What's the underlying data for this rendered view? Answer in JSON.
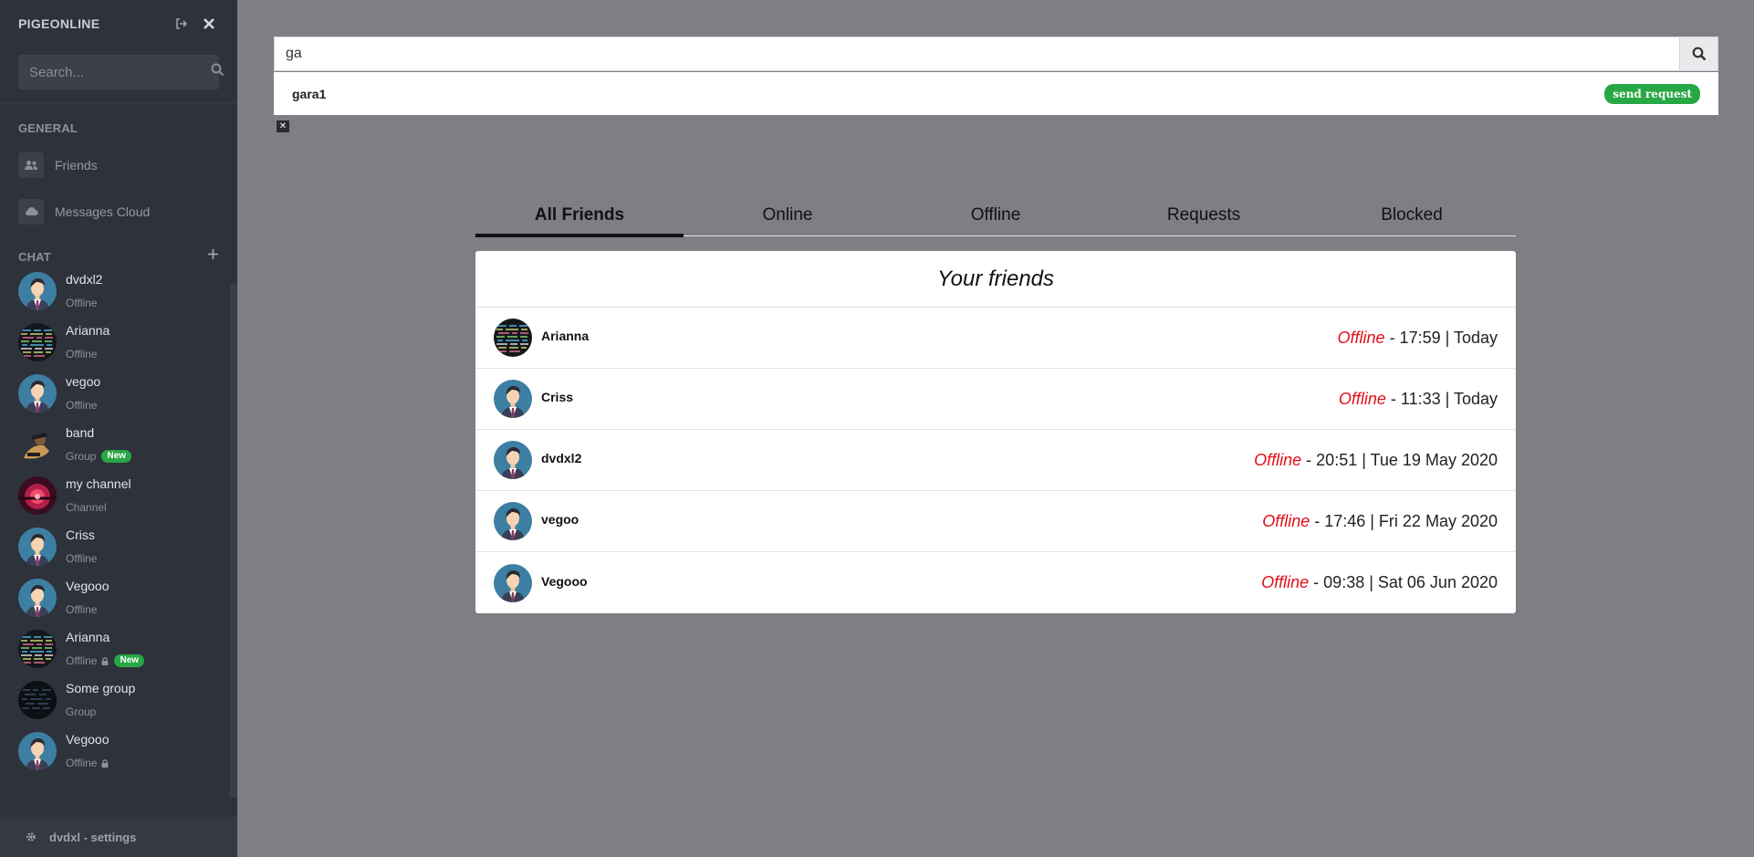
{
  "sidebar": {
    "brand": "PIGEONLINE",
    "search_placeholder": "Search...",
    "general_title": "GENERAL",
    "nav": [
      {
        "label": "Friends",
        "icon": "users-icon"
      },
      {
        "label": "Messages Cloud",
        "icon": "cloud-icon"
      }
    ],
    "chat_title": "CHAT",
    "chats": [
      {
        "name": "dvdxl2",
        "status": "Offline",
        "avatar": "person",
        "new": false,
        "locked": false
      },
      {
        "name": "Arianna",
        "status": "Offline",
        "avatar": "code",
        "new": false,
        "locked": false
      },
      {
        "name": "vegoo",
        "status": "Offline",
        "avatar": "person",
        "new": false,
        "locked": false
      },
      {
        "name": "band",
        "status": "Group",
        "avatar": "band",
        "new": true,
        "locked": false
      },
      {
        "name": "my channel",
        "status": "Channel",
        "avatar": "channel",
        "new": false,
        "locked": false
      },
      {
        "name": "Criss",
        "status": "Offline",
        "avatar": "person",
        "new": false,
        "locked": false
      },
      {
        "name": "Vegooo",
        "status": "Offline",
        "avatar": "person",
        "new": false,
        "locked": false
      },
      {
        "name": "Arianna",
        "status": "Offline",
        "avatar": "code",
        "new": true,
        "locked": true
      },
      {
        "name": "Some group",
        "status": "Group",
        "avatar": "dark",
        "new": false,
        "locked": false
      },
      {
        "name": "Vegooo",
        "status": "Offline",
        "avatar": "person",
        "new": false,
        "locked": true
      }
    ],
    "new_badge": "New",
    "footer": "dvdxl - settings"
  },
  "search": {
    "value": "ga",
    "results": [
      {
        "name": "gara1",
        "action": "send request"
      }
    ],
    "close_label": "✕"
  },
  "tabs": [
    {
      "label": "All Friends",
      "active": true
    },
    {
      "label": "Online",
      "active": false
    },
    {
      "label": "Offline",
      "active": false
    },
    {
      "label": "Requests",
      "active": false
    },
    {
      "label": "Blocked",
      "active": false
    }
  ],
  "friends": {
    "title": "Your friends",
    "list": [
      {
        "name": "Arianna",
        "status": "Offline",
        "last_seen": " - 17:59 | Today",
        "avatar": "code"
      },
      {
        "name": "Criss",
        "status": "Offline",
        "last_seen": " - 11:33 | Today",
        "avatar": "person"
      },
      {
        "name": "dvdxl2",
        "status": "Offline",
        "last_seen": " - 20:51 | Tue 19 May 2020",
        "avatar": "person"
      },
      {
        "name": "vegoo",
        "status": "Offline",
        "last_seen": " - 17:46 | Fri 22 May 2020",
        "avatar": "person"
      },
      {
        "name": "Vegooo",
        "status": "Offline",
        "last_seen": " - 09:38 | Sat 06 Jun 2020",
        "avatar": "person"
      }
    ]
  },
  "colors": {
    "sidebar_bg": "#2e323b",
    "main_bg": "#7d7f85",
    "offline": "#e0101a",
    "success": "#28a745"
  }
}
